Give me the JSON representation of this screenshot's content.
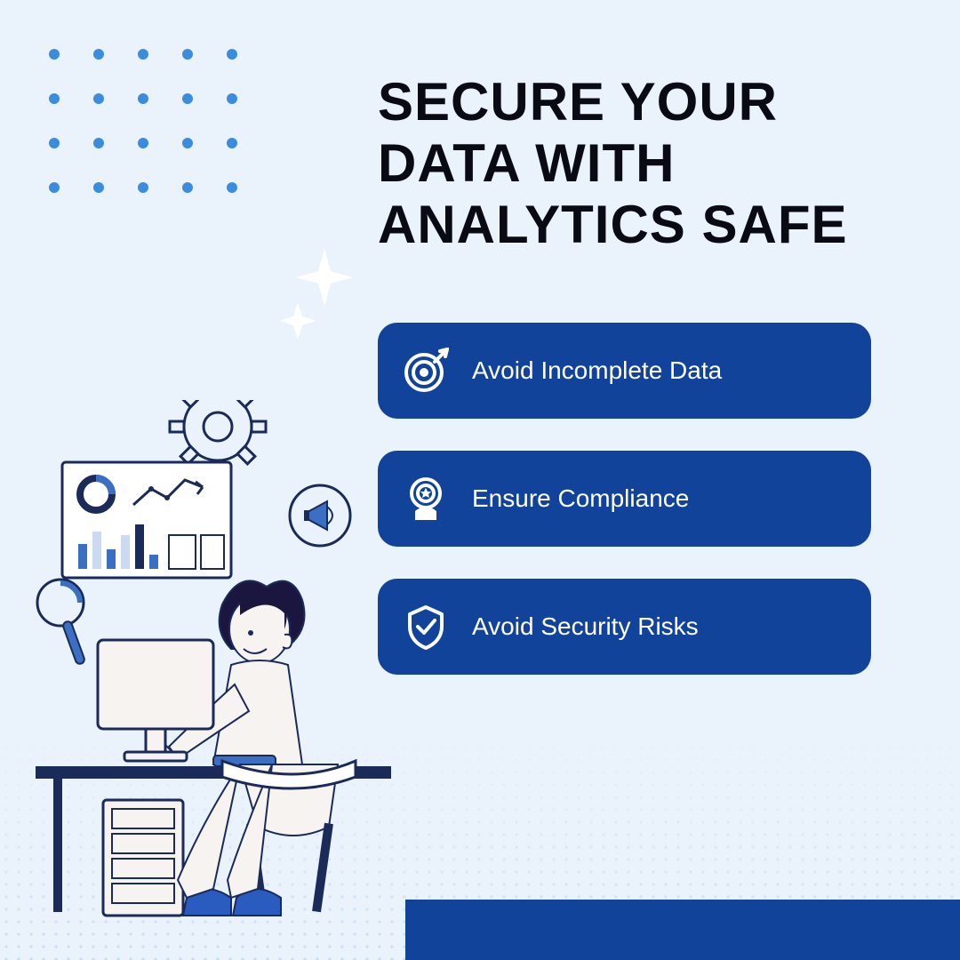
{
  "headline": "SECURE YOUR DATA WITH ANALYTICS SAFE",
  "features": [
    {
      "icon": "target-icon",
      "label": "Avoid Incomplete Data"
    },
    {
      "icon": "badge-icon",
      "label": "Ensure Compliance"
    },
    {
      "icon": "shield-check-icon",
      "label": "Avoid Security Risks"
    }
  ],
  "colors": {
    "background": "#eaf2fb",
    "primary": "#12439a",
    "dots": "#3a8dde",
    "text": "#0a0a14"
  }
}
